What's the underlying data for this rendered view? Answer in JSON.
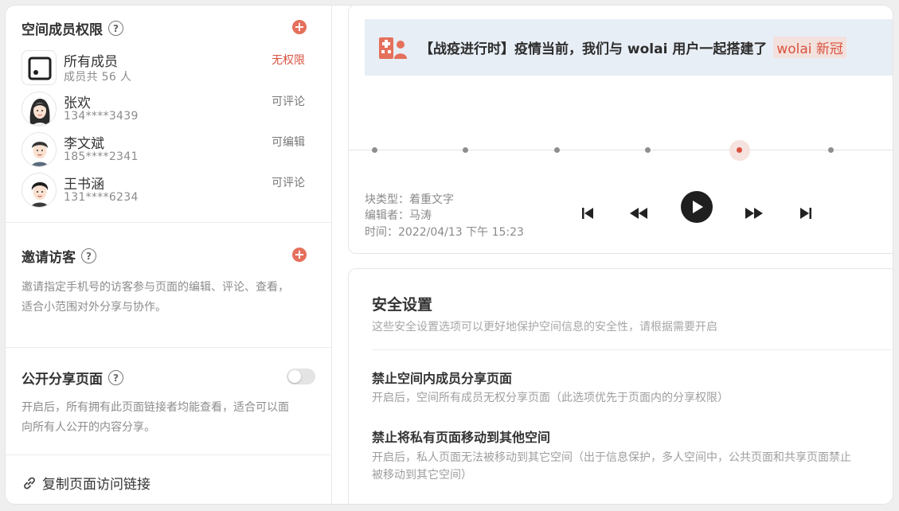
{
  "members_section": {
    "title": "空间成员权限",
    "members": [
      {
        "name": "所有成员",
        "sub": "成员共 56 人",
        "perm": "无权限"
      },
      {
        "name": "张欢",
        "sub": "134****3439",
        "perm": "可评论"
      },
      {
        "name": "李文斌",
        "sub": "185****2341",
        "perm": "可编辑"
      },
      {
        "name": "王书涵",
        "sub": "131****6234",
        "perm": "可评论"
      }
    ]
  },
  "invite_section": {
    "title": "邀请访客",
    "desc_line1": "邀请指定手机号的访客参与页面的编辑、评论、查看，",
    "desc_line2": "适合小范围对外分享与协作。"
  },
  "public_share": {
    "title": "公开分享页面",
    "desc_line1": "开启后，所有拥有此页面链接者均能查看，适合可以面",
    "desc_line2": "向所有人公开的内容分享。",
    "enabled": false
  },
  "copy_link": {
    "label": "复制页面访问链接"
  },
  "banner": {
    "text": "【战疫进行时】疫情当前，我们与 wolai 用户一起搭建了",
    "highlight": "wolai 新冠"
  },
  "history": {
    "block_type": "块类型：着重文字",
    "editor": "编辑者：马涛",
    "time": "时间：2022/04/13 下午 15:23",
    "dot_count": 6,
    "active_dot": 4
  },
  "security": {
    "title": "安全设置",
    "subtitle": "这些安全设置选项可以更好地保护空间信息的安全性，请根据需要开启",
    "items": [
      {
        "title": "禁止空间内成员分享页面",
        "desc_line1": "开启后，空间所有成员无权分享页面（此选项优先于页面内的分享权限）",
        "desc_line2": ""
      },
      {
        "title": "禁止将私有页面移动到其他空间",
        "desc_line1": "开启后，私人页面无法被移动到其它空间（出于信息保护，多人空间中，公共页面和共享页面禁止",
        "desc_line2": "被移动到其它空间）"
      }
    ]
  },
  "colors": {
    "accent": "#d9523f",
    "banner_bg": "#e8eef6"
  }
}
